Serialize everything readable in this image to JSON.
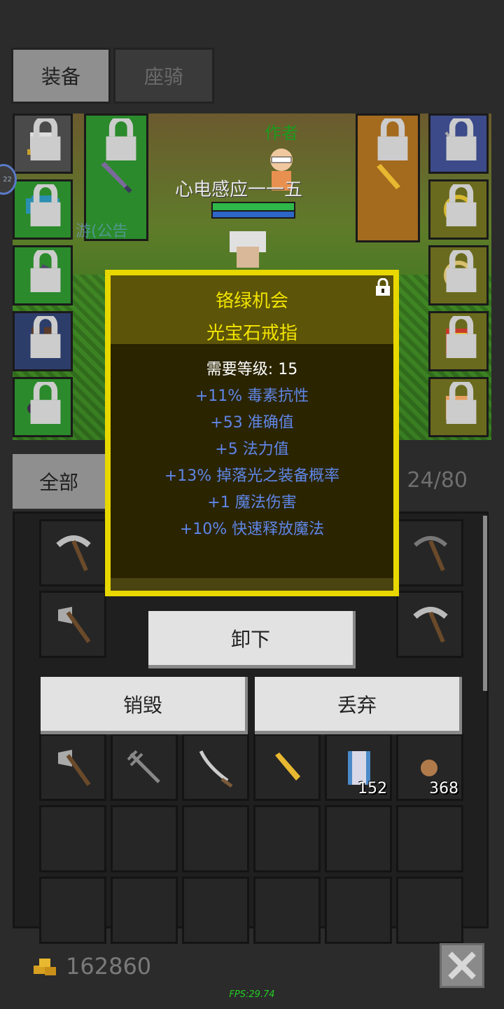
{
  "tabs": [
    {
      "label": "装备"
    },
    {
      "label": "座骑"
    }
  ],
  "scene": {
    "char_name": "作者",
    "guild_name": "心电感应一一五",
    "guild_sub": "游(公告"
  },
  "side_bubble": "22",
  "filter": {
    "label": "全部",
    "count": "24/80"
  },
  "tooltip": {
    "prefix": "铬绿机会",
    "name": "光宝石戒指",
    "requirement": "需要等级: 15",
    "stats": [
      "+11% 毒素抗性",
      "+53 准确值",
      "+5 法力值",
      "+13% 掉落光之装备概率",
      "+1 魔法伤害",
      "+10% 快速释放魔法"
    ]
  },
  "actions": {
    "unequip": "卸下",
    "destroy": "销毁",
    "discard": "丢弃"
  },
  "inventory": {
    "stack_scroll": "152",
    "stack_material": "368"
  },
  "footer": {
    "gold": "162860",
    "fps": "FPS:29.74"
  },
  "colors": {
    "tooltip_border": "#e8d800",
    "stat_blue": "#5f86e8",
    "title_yellow": "#f2e400"
  }
}
